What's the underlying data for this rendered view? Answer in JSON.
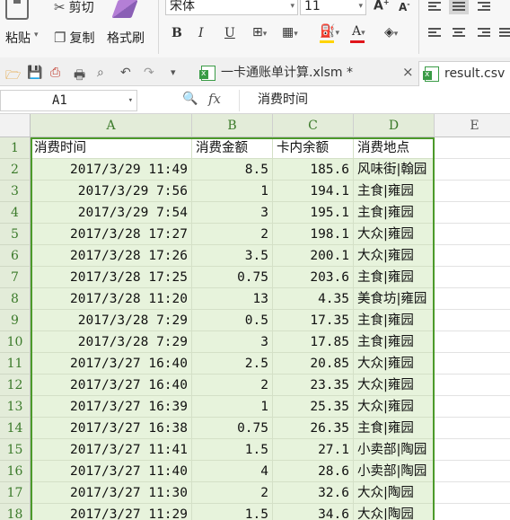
{
  "ribbon": {
    "paste_label": "粘贴",
    "cut_label": "剪切",
    "copy_label": "复制",
    "format_painter_label": "格式刷",
    "font_name": "宋体",
    "font_size": "11",
    "bold_label": "B",
    "italic_label": "I",
    "underline_label": "U",
    "grow_font_label": "A",
    "shrink_font_label": "A",
    "highlight_color": "#ffd400",
    "font_color": "#e0151b"
  },
  "tabs": [
    {
      "label": "一卡通账单计算.xlsm *"
    },
    {
      "label": "result.csv"
    }
  ],
  "formula_bar": {
    "cell_ref": "A1",
    "fx_label": "fx",
    "content": "消费时间"
  },
  "grid": {
    "columns": [
      "A",
      "B",
      "C",
      "D",
      "E"
    ],
    "row_numbers": [
      "1",
      "2",
      "3",
      "4",
      "5",
      "6",
      "7",
      "8",
      "9",
      "10",
      "11",
      "12",
      "13",
      "14",
      "15",
      "16",
      "17",
      "18"
    ],
    "header_row": [
      "消费时间",
      "消费金额",
      "卡内余额",
      "消费地点"
    ],
    "rows": [
      [
        "2017/3/29 11:49",
        "8.5",
        "185.6",
        "风味街|翰园"
      ],
      [
        "2017/3/29 7:56",
        "1",
        "194.1",
        "主食|雍园"
      ],
      [
        "2017/3/29 7:54",
        "3",
        "195.1",
        "主食|雍园"
      ],
      [
        "2017/3/28 17:27",
        "2",
        "198.1",
        "大众|雍园"
      ],
      [
        "2017/3/28 17:26",
        "3.5",
        "200.1",
        "大众|雍园"
      ],
      [
        "2017/3/28 17:25",
        "0.75",
        "203.6",
        "主食|雍园"
      ],
      [
        "2017/3/28 11:20",
        "13",
        "4.35",
        "美食坊|雍园"
      ],
      [
        "2017/3/28 7:29",
        "0.5",
        "17.35",
        "主食|雍园"
      ],
      [
        "2017/3/28 7:29",
        "3",
        "17.85",
        "主食|雍园"
      ],
      [
        "2017/3/27 16:40",
        "2.5",
        "20.85",
        "大众|雍园"
      ],
      [
        "2017/3/27 16:40",
        "2",
        "23.35",
        "大众|雍园"
      ],
      [
        "2017/3/27 16:39",
        "1",
        "25.35",
        "大众|雍园"
      ],
      [
        "2017/3/27 16:38",
        "0.75",
        "26.35",
        "主食|雍园"
      ],
      [
        "2017/3/27 11:41",
        "1.5",
        "27.1",
        "小卖部|陶园"
      ],
      [
        "2017/3/27 11:40",
        "4",
        "28.6",
        "小卖部|陶园"
      ],
      [
        "2017/3/27 11:30",
        "2",
        "32.6",
        "大众|陶园"
      ],
      [
        "2017/3/27 11:29",
        "1.5",
        "34.6",
        "大众|陶园"
      ]
    ]
  },
  "colors": {
    "selection_border": "#4c9a2a",
    "selection_fill": "#e7f3dc",
    "header_selected_fill": "#e3ecd9"
  }
}
